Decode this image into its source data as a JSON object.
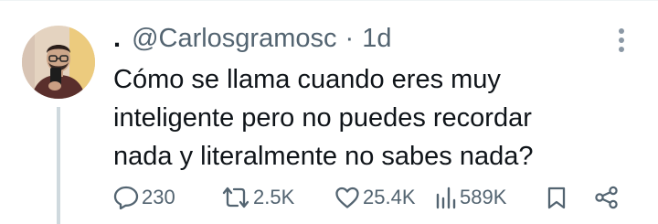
{
  "tweet": {
    "display_name": ".",
    "handle": "@Carlosgramosc",
    "separator": "·",
    "timestamp": "1d",
    "text_lines": [
      "Cómo se llama cuando eres muy",
      "inteligente pero no puedes recordar",
      "nada y literalmente no sabes nada?"
    ]
  },
  "actions": {
    "replies": "230",
    "reposts": "2.5K",
    "likes": "25.4K",
    "views": "589K"
  },
  "icons": {
    "more": "more-vertical-icon",
    "reply": "reply-icon",
    "repost": "repost-icon",
    "like": "heart-icon",
    "views": "views-chart-icon",
    "bookmark": "bookmark-icon",
    "share": "share-icon"
  },
  "colors": {
    "text": "#0f1419",
    "secondary": "#536471",
    "thread_line": "#cfd9de"
  }
}
